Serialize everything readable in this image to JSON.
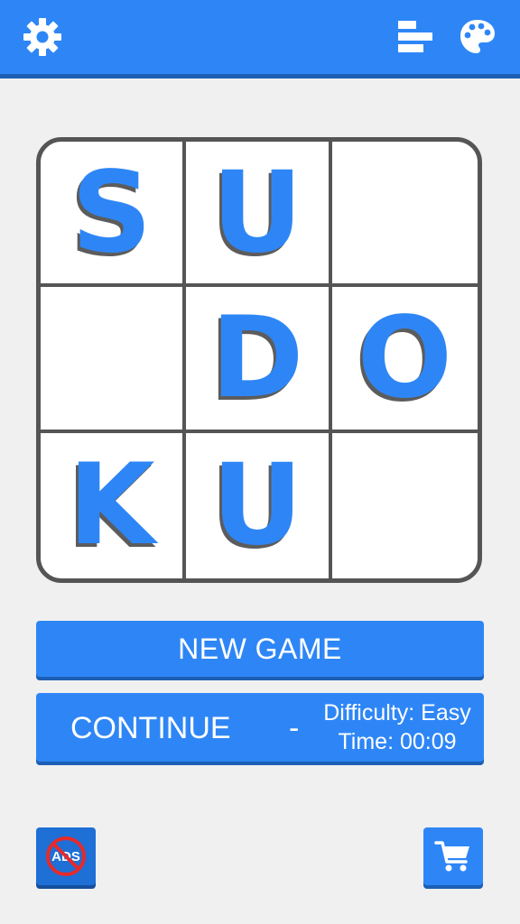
{
  "toolbar": {
    "icons": [
      "gear-icon",
      "leaderboard-icon",
      "palette-icon"
    ],
    "color": "#2e86f6"
  },
  "logo_board": {
    "cells": [
      "S",
      "U",
      "",
      "",
      "D",
      "O",
      "K",
      "U",
      ""
    ],
    "letter_color": "#2e86f6"
  },
  "buttons": {
    "new_game": "NEW GAME",
    "continue": "CONTINUE",
    "separator": "-",
    "difficulty": "Difficulty: Easy",
    "time": "Time: 00:09"
  },
  "bottom": {
    "no_ads_label": "ADS",
    "shop_icon": "cart-icon"
  }
}
